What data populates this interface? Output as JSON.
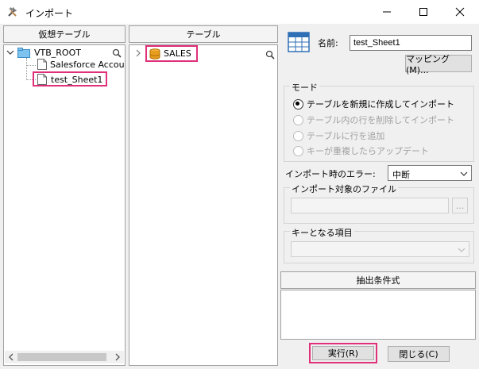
{
  "window": {
    "title": "インポート"
  },
  "left_panel": {
    "header": "仮想テーブル",
    "tree": {
      "root": "VTB_ROOT",
      "children": [
        "Salesforce Accou",
        "test_Sheet1"
      ]
    }
  },
  "middle_panel": {
    "header": "テーブル",
    "items": [
      "SALES"
    ]
  },
  "right_panel": {
    "name_label": "名前:",
    "name_value": "test_Sheet1",
    "mapping_button": "マッピング(M)...",
    "mode": {
      "title": "モード",
      "options": [
        "テーブルを新規に作成してインポート",
        "テーブル内の行を削除してインポート",
        "テーブルに行を追加",
        "キーが重複したらアップデート"
      ],
      "selected_index": 0
    },
    "error_label": "インポート時のエラー:",
    "error_value": "中断",
    "file_group_title": "インポート対象のファイル",
    "file_value": "",
    "browse_label": "...",
    "key_group_title": "キーとなる項目",
    "key_value": "",
    "filter_header": "抽出条件式",
    "filter_text": ""
  },
  "footer": {
    "run_button": "実行(R)",
    "close_button": "閉じる(C)"
  },
  "colors": {
    "highlight": "#e0307a",
    "selection": "#0078d7"
  }
}
